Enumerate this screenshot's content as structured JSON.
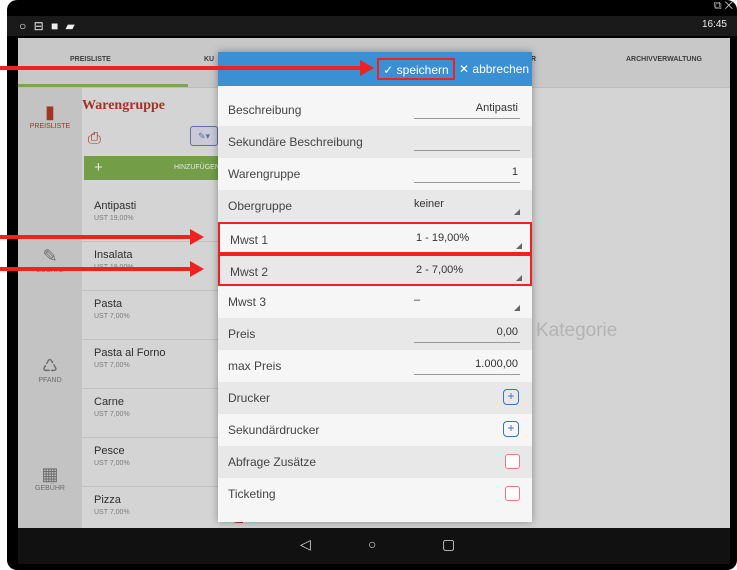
{
  "status_bar": {
    "left_icons": "○ ⊟ ■ ▰",
    "time": "16:45",
    "window_icons": "⧉ ✕"
  },
  "topnav": {
    "tabs": [
      "PREISLISTE",
      "KU",
      "R",
      "ARCHIVVERWALTUNG"
    ]
  },
  "sidebar": {
    "items": [
      {
        "label": "PREISLISTE",
        "icon": "bottle-icon"
      },
      {
        "label": "ZUSATZ",
        "icon": "pencil-icon"
      },
      {
        "label": "PFAND",
        "icon": "recycle-icon"
      },
      {
        "label": "GEBÜHR",
        "icon": "fee-icon"
      }
    ]
  },
  "category": {
    "title": "Warengruppe",
    "add_label": "HINZUFÜGEN"
  },
  "products": [
    {
      "name": "Antipasti",
      "tax": "UST 19,00%"
    },
    {
      "name": "Insalata",
      "tax": "UST 19,00%"
    },
    {
      "name": "Pasta",
      "tax": "UST 7,00%"
    },
    {
      "name": "Pasta al Forno",
      "tax": "UST 7,00%"
    },
    {
      "name": "Carne",
      "tax": "UST 7,00%"
    },
    {
      "name": "Pesce",
      "tax": "UST 7,00%"
    },
    {
      "name": "Pizza",
      "tax": "UST 7,00%"
    }
  ],
  "background_text": "Kategorie",
  "dialog": {
    "save_label": "✓ speichern",
    "cancel_label": "✕ abbrechen",
    "fields": [
      {
        "label": "Beschreibung",
        "value": "Antipasti",
        "kind": "text"
      },
      {
        "label": "Sekundäre Beschreibung",
        "value": "",
        "kind": "text"
      },
      {
        "label": "Warengruppe",
        "value": "1",
        "kind": "text"
      },
      {
        "label": "Obergruppe",
        "value": "keiner",
        "kind": "select"
      },
      {
        "label": "Mwst 1",
        "value": "1 - 19,00%",
        "kind": "select"
      },
      {
        "label": "Mwst 2",
        "value": "2 - 7,00%",
        "kind": "select"
      },
      {
        "label": "Mwst 3",
        "value": "–",
        "kind": "select"
      },
      {
        "label": "Preis",
        "value": "0,00",
        "kind": "text"
      },
      {
        "label": "max Preis",
        "value": "1.000,00",
        "kind": "text"
      },
      {
        "label": "Drucker",
        "value": "",
        "kind": "plus"
      },
      {
        "label": "Sekundärdrucker",
        "value": "",
        "kind": "plus"
      },
      {
        "label": "Abfrage Zusätze",
        "value": "",
        "kind": "checkbox"
      },
      {
        "label": "Ticketing",
        "value": "",
        "kind": "checkbox"
      }
    ]
  },
  "android_nav": {
    "back": "◁",
    "home": "○",
    "recents": "▢"
  },
  "colors": {
    "header_blue": "#3b8fd3",
    "accent_red": "#e22222",
    "add_green": "#7fae4f"
  }
}
